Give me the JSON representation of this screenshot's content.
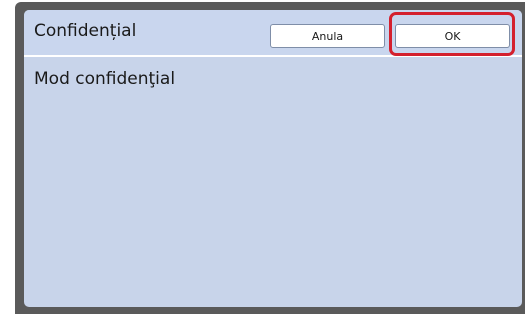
{
  "header": {
    "title": "Confidențial",
    "cancel_label": "Anula",
    "ok_label": "OK"
  },
  "main": {
    "mode_label": "Mod confidenţial"
  },
  "colors": {
    "screen_background": "#c8d4ea",
    "highlight": "#d4202e"
  }
}
